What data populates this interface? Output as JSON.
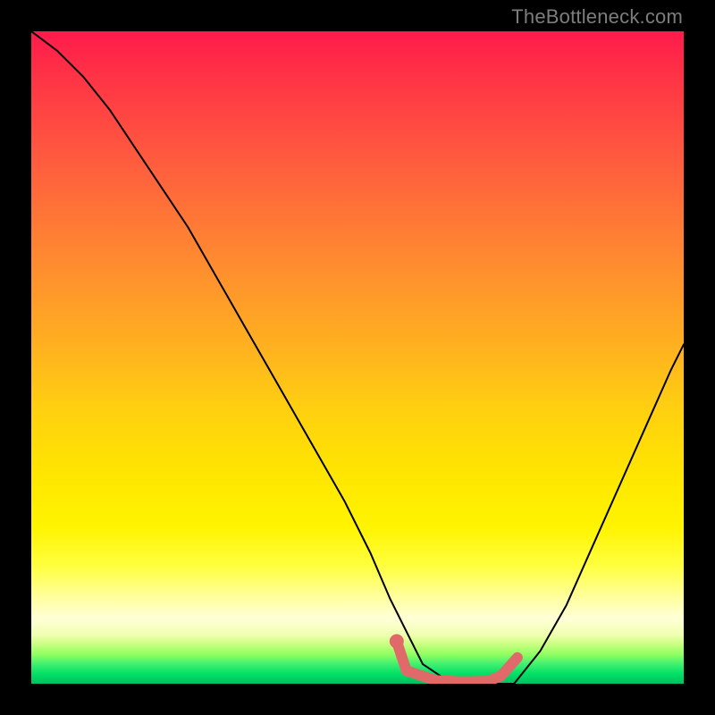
{
  "watermark": "TheBottleneck.com",
  "colors": {
    "curve": "#000000",
    "marker": "#e06a6a",
    "background": "#000000"
  },
  "chart_data": {
    "type": "line",
    "title": "",
    "xlabel": "",
    "ylabel": "",
    "xlim": [
      0,
      100
    ],
    "ylim": [
      0,
      100
    ],
    "grid": false,
    "legend": false,
    "series": [
      {
        "name": "bottleneck-curve",
        "x": [
          0,
          4,
          8,
          12,
          16,
          20,
          24,
          28,
          32,
          36,
          40,
          44,
          48,
          52,
          55,
          58,
          60,
          63,
          66,
          70,
          74,
          78,
          82,
          86,
          90,
          94,
          98,
          100
        ],
        "y": [
          100,
          97,
          93,
          88,
          82,
          76,
          70,
          63,
          56,
          49,
          42,
          35,
          28,
          20,
          13,
          7,
          3,
          1,
          0,
          0,
          0,
          5,
          12,
          21,
          30,
          39,
          48,
          52
        ]
      }
    ],
    "annotations": [
      {
        "name": "optimal-range-marker",
        "type": "polyline",
        "points_x": [
          56,
          57.5,
          62,
          66,
          70,
          72,
          74.5
        ],
        "points_y": [
          6.5,
          2,
          0.5,
          0.3,
          0.4,
          1.2,
          4
        ]
      },
      {
        "name": "optimal-start-dot",
        "type": "dot",
        "x": 56,
        "y": 6.5
      }
    ]
  }
}
